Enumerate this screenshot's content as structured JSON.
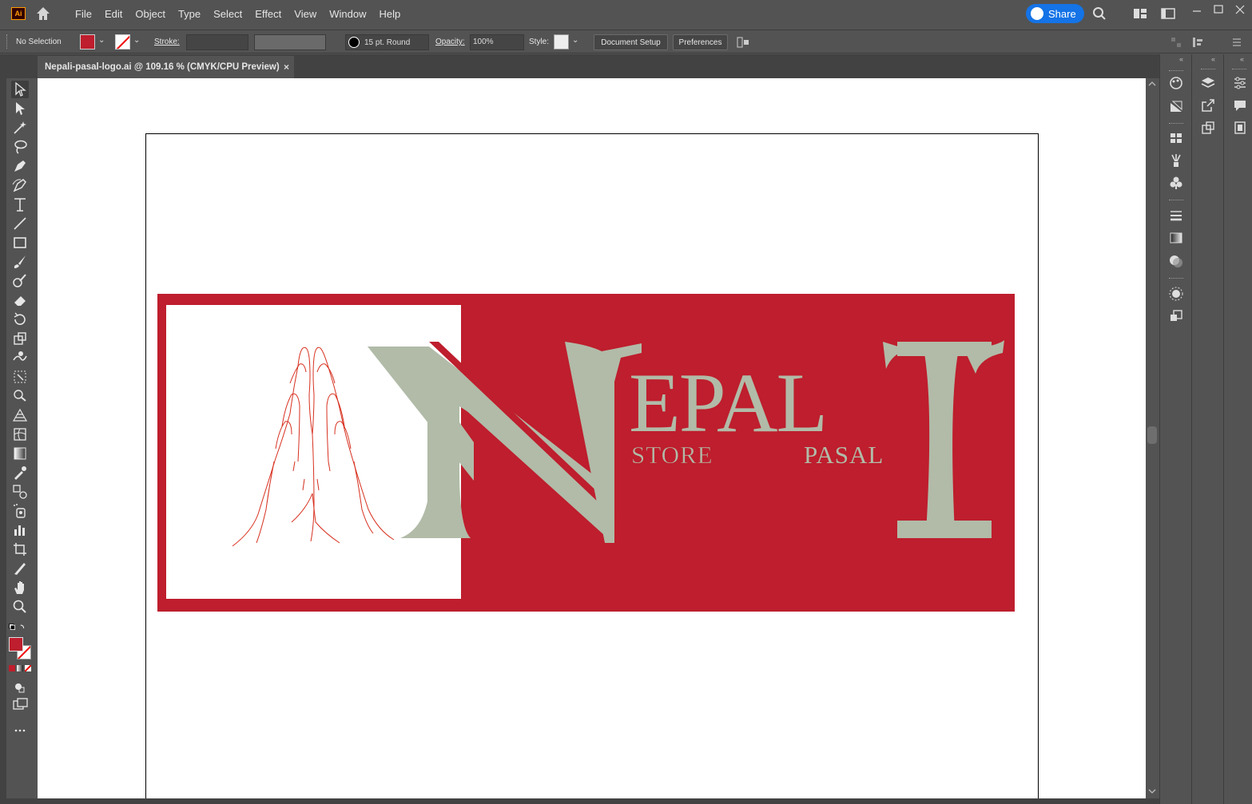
{
  "app": {
    "logo_text": "Ai",
    "menu": [
      "File",
      "Edit",
      "Object",
      "Type",
      "Select",
      "Effect",
      "View",
      "Window",
      "Help"
    ],
    "share_label": "Share"
  },
  "control_bar": {
    "selection": "No Selection",
    "stroke_label": "Stroke:",
    "brush": "15 pt. Round",
    "opacity_label": "Opacity:",
    "opacity_value": "100%",
    "style_label": "Style:",
    "document_setup": "Document Setup",
    "preferences": "Preferences"
  },
  "document": {
    "tab_title": "Nepali-pasal-logo.ai @ 109.16 % (CMYK/CPU Preview)",
    "close": "×"
  },
  "artwork": {
    "letters": [
      "N",
      "E",
      "P",
      "A",
      "L",
      "I"
    ],
    "sub_left": "STORE",
    "sub_right": "PASAL",
    "colors": {
      "red": "#be1e2d",
      "sage": "#b1bba8",
      "hands": "#d7301f"
    }
  },
  "tools": [
    "selection-tool",
    "direct-selection-tool",
    "magic-wand-tool",
    "lasso-tool",
    "pen-tool",
    "curvature-tool",
    "type-tool",
    "line-tool",
    "rectangle-tool",
    "paintbrush-tool",
    "shaper-tool",
    "eraser-tool",
    "rotate-tool",
    "scale-tool",
    "warp-tool",
    "free-transform-tool",
    "shape-builder-tool",
    "perspective-grid-tool",
    "mesh-tool",
    "gradient-tool",
    "eyedropper-tool",
    "blend-tool",
    "symbol-sprayer-tool",
    "column-graph-tool",
    "artboard-tool",
    "slice-tool",
    "hand-tool",
    "zoom-tool"
  ],
  "colors": {
    "fill": "#be1e2d"
  }
}
